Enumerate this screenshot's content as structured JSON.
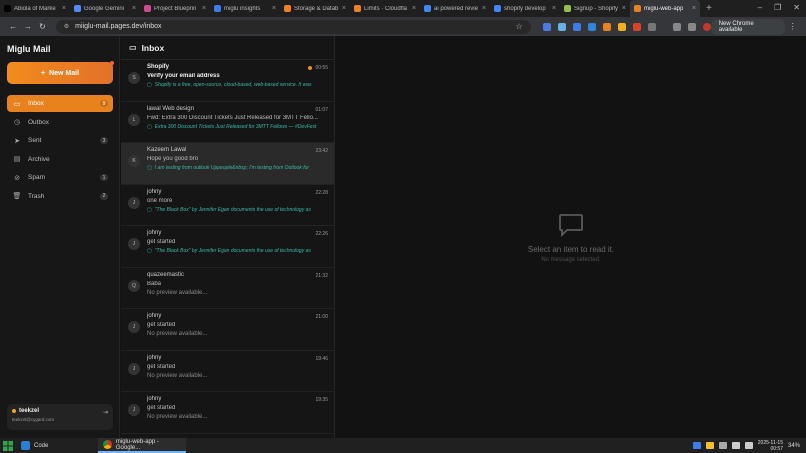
{
  "browser": {
    "tabs": [
      {
        "title": "Abiola of Marke",
        "color": "#000000"
      },
      {
        "title": "Google Gemini",
        "color": "#4f8cf7"
      },
      {
        "title": "Project Blueprin",
        "color": "#c94d8f"
      },
      {
        "title": "miglu insights",
        "color": "#3d7de8"
      },
      {
        "title": "Storage & Datab",
        "color": "#f38020"
      },
      {
        "title": "Limits · Cloudfla",
        "color": "#f38020"
      },
      {
        "title": "ai powered revie",
        "color": "#4285f4"
      },
      {
        "title": "shopify develop",
        "color": "#4285f4"
      },
      {
        "title": "Signup - Shopify",
        "color": "#95bf47"
      },
      {
        "title": "miglu-web-app",
        "color": "#e8821f"
      }
    ],
    "url": "miiglu-mail.pages.dev/inbox",
    "update_label": "New Chrome available",
    "window_controls": [
      "–",
      "❐",
      "✕"
    ]
  },
  "sidebar": {
    "brand": "Miglu Mail",
    "new_mail_label": "New Mail",
    "items": [
      {
        "label": "Inbox",
        "icon": "inbox-icon",
        "glyph": "▭",
        "count": "9",
        "active": true
      },
      {
        "label": "Outbox",
        "icon": "clock-icon",
        "glyph": "◷",
        "count": "",
        "active": false
      },
      {
        "label": "Sent",
        "icon": "send-icon",
        "glyph": "➤",
        "count": "3",
        "active": false
      },
      {
        "label": "Archive",
        "icon": "archive-icon",
        "glyph": "▤",
        "count": "",
        "active": false
      },
      {
        "label": "Spam",
        "icon": "spam-icon",
        "glyph": "⊘",
        "count": "1",
        "active": false
      },
      {
        "label": "Trash",
        "icon": "trash-icon",
        "glyph": "🗑",
        "count": "2",
        "active": false
      }
    ],
    "user": {
      "name": "teekzel",
      "email": "teekzel@cygard.com"
    }
  },
  "list": {
    "title": "Inbox",
    "mails": [
      {
        "initial": "S",
        "from": "Shopify",
        "time": "00:55",
        "subject": "Verify your email address",
        "preview": "Shopify is a free, open-source, cloud-based, web-based service. It was",
        "unread": true,
        "selected": false
      },
      {
        "initial": "L",
        "from": "lawal Web design",
        "time": "01:07",
        "subject": "Fwd: Extra 300 Discount Tickets Just Released for 3MTT Fello...",
        "preview": "Extra 300 Discount Tickets Just Released for 3MTT Fellows — #DevFest",
        "unread": false,
        "selected": false
      },
      {
        "initial": "K",
        "from": "Kazeem Lawal",
        "time": "23:42",
        "subject": "Hope you good bro",
        "preview": "I am testing from outlook Uppeople&nbsp; I'm testing from Outlook for",
        "unread": false,
        "selected": true
      },
      {
        "initial": "J",
        "from": "johny",
        "time": "22:28",
        "subject": "one more",
        "preview": "\"The Black Box\" by Jennifer Egan documents the use of technology as",
        "unread": false,
        "selected": false
      },
      {
        "initial": "J",
        "from": "johny",
        "time": "22:26",
        "subject": "get started",
        "preview": "\"The Black Box\" by Jennifer Egan documents the use of technology as",
        "unread": false,
        "selected": false
      },
      {
        "initial": "Q",
        "from": "quazeemastic",
        "time": "21:32",
        "subject": "Baba",
        "preview": "",
        "nopreview": "No preview available...",
        "unread": false,
        "selected": false
      },
      {
        "initial": "J",
        "from": "johny",
        "time": "21:00",
        "subject": "get started",
        "preview": "",
        "nopreview": "No preview available...",
        "unread": false,
        "selected": false
      },
      {
        "initial": "J",
        "from": "johny",
        "time": "19:46",
        "subject": "get started",
        "preview": "",
        "nopreview": "No preview available...",
        "unread": false,
        "selected": false
      },
      {
        "initial": "J",
        "from": "johny",
        "time": "19:35",
        "subject": "get started",
        "preview": "",
        "nopreview": "No preview available...",
        "unread": false,
        "selected": false
      }
    ]
  },
  "reader": {
    "empty_title": "Select an item to read it.",
    "empty_subtitle": "No message selected."
  },
  "taskbar": {
    "code_label": "Code",
    "chrome_label": "miglu-web-app - Google...",
    "time": "2025-11-15",
    "clock": "00:57",
    "battery": "34%"
  }
}
